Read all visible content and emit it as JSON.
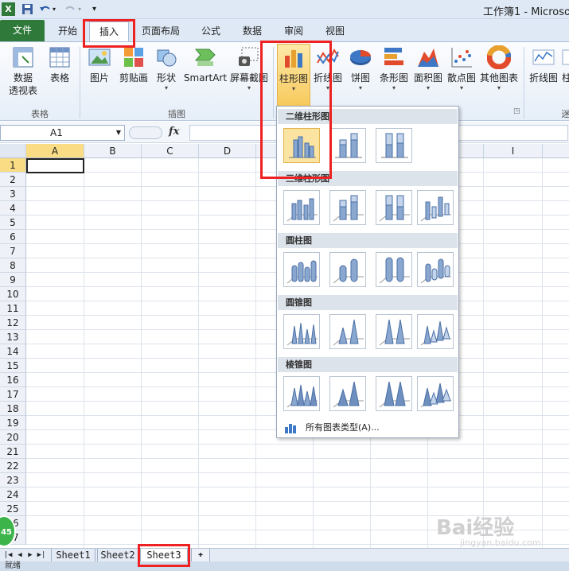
{
  "window": {
    "title": "工作簿1 - Microso"
  },
  "tabs": [
    {
      "label": "文件"
    },
    {
      "label": "开始"
    },
    {
      "label": "插入"
    },
    {
      "label": "页面布局"
    },
    {
      "label": "公式"
    },
    {
      "label": "数据"
    },
    {
      "label": "审阅"
    },
    {
      "label": "视图"
    }
  ],
  "ribbon": {
    "pivot_label": "数据",
    "pivot_label2": "透视表",
    "table_label": "表格",
    "picture_label": "图片",
    "clipart_label": "剪贴画",
    "shapes_label": "形状",
    "smartart_label": "SmartArt",
    "screenshot_label": "屏幕截图",
    "column_label": "柱形图",
    "line_label": "折线图",
    "pie_label": "饼图",
    "bar_label": "条形图",
    "area_label": "面积图",
    "scatter_label": "散点图",
    "other_label": "其他图表",
    "sparkline_line_label": "折线图",
    "sparkline_col_label": "柱",
    "group_tables": "表格",
    "group_illustrations": "插图",
    "group_sparklines": "迷"
  },
  "formula_bar": {
    "cell": "A1",
    "fx": "fx",
    "value": ""
  },
  "grid": {
    "columns": [
      "A",
      "B",
      "C",
      "D",
      "I"
    ],
    "rows": [
      "1",
      "2",
      "3",
      "4",
      "5",
      "6",
      "7",
      "8",
      "9",
      "10",
      "11",
      "12",
      "13",
      "14",
      "15",
      "16",
      "17",
      "18",
      "19",
      "20",
      "21",
      "22",
      "23",
      "24",
      "25",
      "26",
      "27"
    ]
  },
  "chart_menu": {
    "sections": [
      "二维柱形图",
      "三维柱形图",
      "圆柱图",
      "圆锥图",
      "棱锥图"
    ],
    "all_types": "所有图表类型(A)..."
  },
  "sheets": [
    "Sheet1",
    "Sheet2",
    "Sheet3"
  ],
  "status": {
    "text": "就绪"
  },
  "badge": {
    "text": "45"
  },
  "watermark": {
    "text": "Bai经验",
    "sub": "jingyan.baidu.com"
  },
  "colors": {
    "accent": "#2f7a3b",
    "highlight": "#e22222",
    "ribbon_bg": "#dfe9f5"
  }
}
